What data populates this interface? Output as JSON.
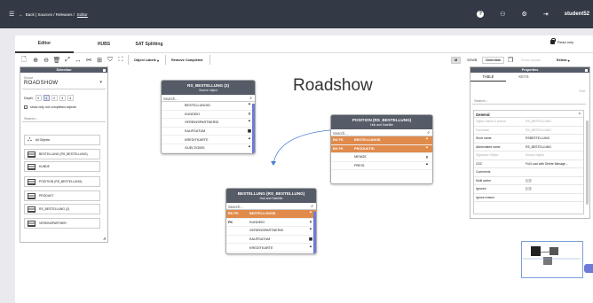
{
  "topbar": {
    "back": "Back | Sources / Releases / ",
    "current": "Editor",
    "user": "student52"
  },
  "tabs": [
    "Editor",
    "HUBS",
    "SAT Splitting"
  ],
  "read_only": "Read only",
  "toolbar": {
    "object_labels": "Object Labels",
    "remove_completed": "Remove Completed",
    "size_label": "M",
    "sdwb": "SDWB",
    "overview": "Overview",
    "show_update": "Show update",
    "extras": "Extras"
  },
  "selection": {
    "title": "Selection",
    "source_label": "Source",
    "source_value": "ROADSHOW",
    "depth_label": "Depth:",
    "depths": [
      "0",
      "1",
      "2",
      "3",
      "4"
    ],
    "show_only": "show only not completed objects",
    "search_placeholder": "Search...",
    "objects": [
      "All Objects",
      "BESTELLUNG (RS_BESTELLUNG)",
      "KUNDE",
      "POSITION (RS_BESTELLUNG)",
      "PRODUKT",
      "RS_BESTELLUNG (2)",
      "VEREINSPARTNER"
    ]
  },
  "canvas": {
    "title": "Roadshow",
    "search_placeholder": "Search...",
    "entities": [
      {
        "title": "RS_BESTELLUNG (2)",
        "subtitle": "Source object",
        "rows": [
          {
            "key": "",
            "name": "BESTELLUNGID",
            "type": "quote"
          },
          {
            "key": "",
            "name": "KUNDEID",
            "type": "#"
          },
          {
            "key": "",
            "name": "VEREINSPARTNERID",
            "type": "quote"
          },
          {
            "key": "",
            "name": "KAUFDATUM",
            "type": "date"
          },
          {
            "key": "",
            "name": "KREDITKARTE",
            "type": "quote"
          },
          {
            "key": "",
            "name": "GUELTIGBIS",
            "type": "quote"
          }
        ]
      },
      {
        "title": "POSITION (RS_BESTELLUNG)",
        "subtitle": "Hub and Satellite",
        "rows": [
          {
            "key": "BK FK",
            "name": "BESTELLUNGID",
            "type": "quote",
            "hl": true
          },
          {
            "key": "BK FK",
            "name": "PRODUKTID",
            "type": "quote",
            "hl": true
          },
          {
            "key": "",
            "name": "MENGE",
            "type": "#"
          },
          {
            "key": "",
            "name": "PREIS",
            "type": "quote"
          }
        ]
      },
      {
        "title": "BESTELLUNG (RS_BESTELLUNG)",
        "subtitle": "Hub and Satellite",
        "rows": [
          {
            "key": "BK PK",
            "name": "BESTELLUNGID",
            "type": "quote",
            "hl": true
          },
          {
            "key": "FK",
            "name": "KUNDEID",
            "type": "#"
          },
          {
            "key": "",
            "name": "VEREINSPARTNERID",
            "type": "quote"
          },
          {
            "key": "",
            "name": "KAUFDATUM",
            "type": "date"
          },
          {
            "key": "",
            "name": "KREDITKARTE",
            "type": "quote"
          },
          {
            "key": "",
            "name": "GUELTIGBIS",
            "type": "quote"
          }
        ]
      }
    ]
  },
  "properties": {
    "title": "Properties",
    "tabs": [
      "TABLE",
      "KEYS"
    ],
    "edit": "Edit",
    "search_placeholder": "Search...",
    "group": "General",
    "rows": [
      {
        "k": "Object name in source",
        "v": "RS_BESTELLUNG",
        "dim": true
      },
      {
        "k": "Full name",
        "v": "RS_BESTELLUNG",
        "dim": true
      },
      {
        "k": "Short name",
        "v": "RSBESTELLUNG",
        "dim": false
      },
      {
        "k": "Abbreviated name",
        "v": "RS_BESTELLUNG",
        "dim": false
      },
      {
        "k": "Signature Object",
        "v": "Source object",
        "dim": true
      },
      {
        "k": "CDC",
        "v": "Full Load with Delete Manage...",
        "dim": false
      },
      {
        "k": "Comments",
        "v": "",
        "dim": false
      },
      {
        "k": "Multi active",
        "v": "",
        "toggle": true,
        "dim": false
      },
      {
        "k": "Ignored",
        "v": "",
        "toggle": true,
        "dim": false
      },
      {
        "k": "Ignore reason",
        "v": "",
        "dim": false
      }
    ]
  },
  "colors": {
    "topbar": "#333a45",
    "header": "#555c68",
    "key_row": "#e08b4c",
    "accent": "#6d7ad6"
  }
}
